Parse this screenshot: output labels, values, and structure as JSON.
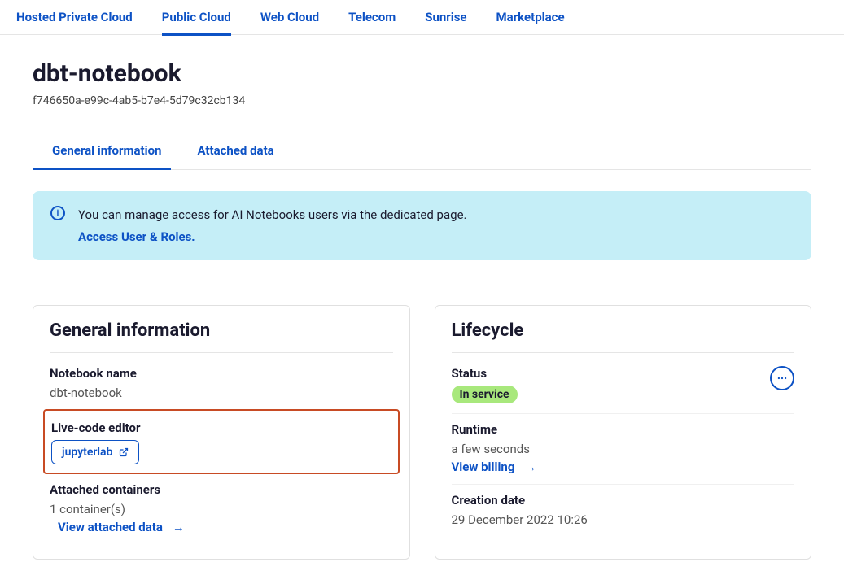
{
  "top_nav": [
    "Hosted Private Cloud",
    "Public Cloud",
    "Web Cloud",
    "Telecom",
    "Sunrise",
    "Marketplace"
  ],
  "top_nav_active": 1,
  "page": {
    "title": "dbt-notebook",
    "id": "f746650a-e99c-4ab5-b7e4-5d79c32cb134"
  },
  "tabs": [
    "General information",
    "Attached data"
  ],
  "tabs_active": 0,
  "banner": {
    "text": "You can manage access for AI Notebooks users via the dedicated page.",
    "link": "Access User & Roles."
  },
  "general_info": {
    "card_title": "General information",
    "notebook_name_label": "Notebook name",
    "notebook_name_value": "dbt-notebook",
    "live_code_editor_label": "Live-code editor",
    "live_code_editor_value": "jupyterlab",
    "attached_containers_label": "Attached containers",
    "attached_containers_value": "1 container(s)",
    "view_attached_data_link": "View attached data"
  },
  "lifecycle": {
    "card_title": "Lifecycle",
    "status_label": "Status",
    "status_value": "In service",
    "runtime_label": "Runtime",
    "runtime_value": "a few seconds",
    "view_billing_link": "View billing",
    "creation_date_label": "Creation date",
    "creation_date_value": "29 December 2022 10:26"
  }
}
